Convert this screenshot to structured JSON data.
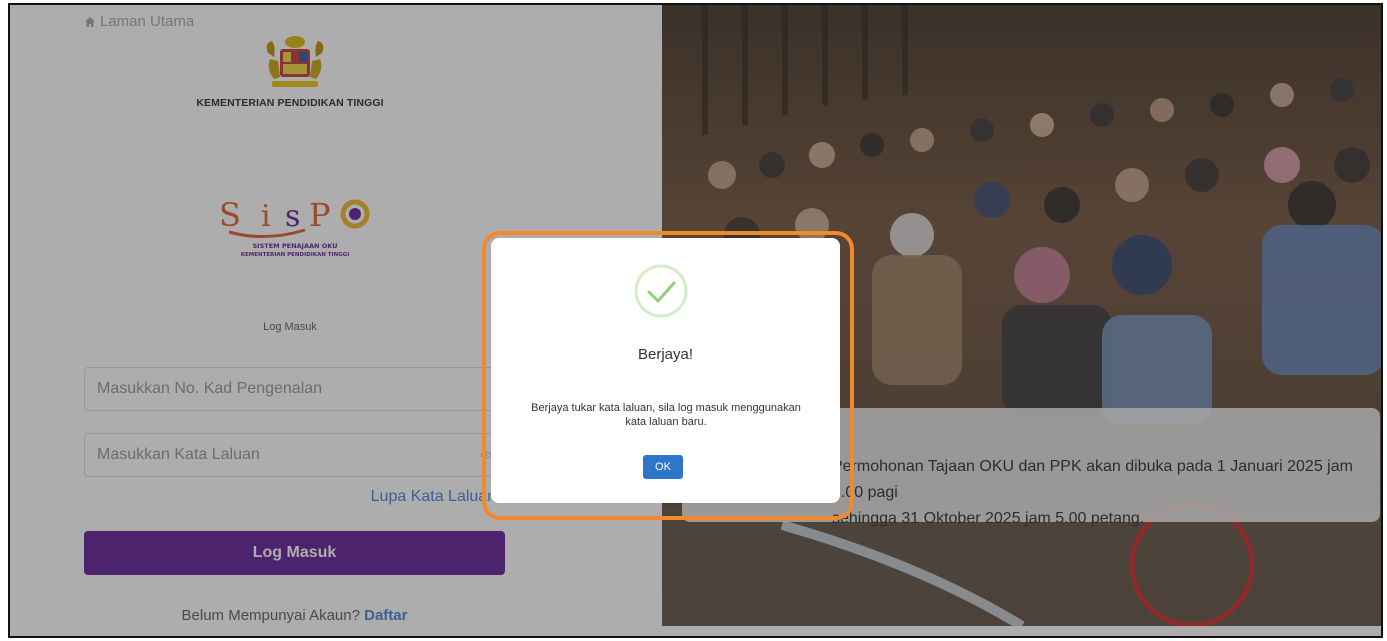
{
  "left": {
    "home_label": "Laman Utama",
    "ministry_name": "KEMENTERIAN PENDIDIKAN TINGGI",
    "logo": {
      "wordmark": "SisPO",
      "tagline_1": "SISTEM PENAJAAN OKU",
      "tagline_2": "KEMENTERIAN PENDIDIKAN TINGGI"
    },
    "login_heading": "Log Masuk",
    "ic_placeholder": "Masukkan No. Kad Pengenalan",
    "password_placeholder": "Masukkan Kata Laluan",
    "forgot_label": "Lupa Kata Laluan?",
    "login_button": "Log Masuk",
    "register_prompt": "Belum Mempunyai Akaun?",
    "register_link": "Daftar"
  },
  "right": {
    "notice_line_1": "Permohonan Tajaan OKU dan PPK akan dibuka pada 1 Januari 2025 jam 8.00 pagi",
    "notice_line_2": "sehingga 31 Oktober 2025 jam 5.00 petang."
  },
  "modal": {
    "title": "Berjaya!",
    "message": "Berjaya tukar kata laluan, sila log masuk menggunakan kata laluan baru.",
    "ok_label": "OK"
  },
  "colors": {
    "primary_purple": "#5b1293",
    "link_blue": "#3e7ad1",
    "ok_blue": "#2e77c8",
    "success_green": "#8fd17a",
    "highlight_orange": "#f08a2c"
  }
}
